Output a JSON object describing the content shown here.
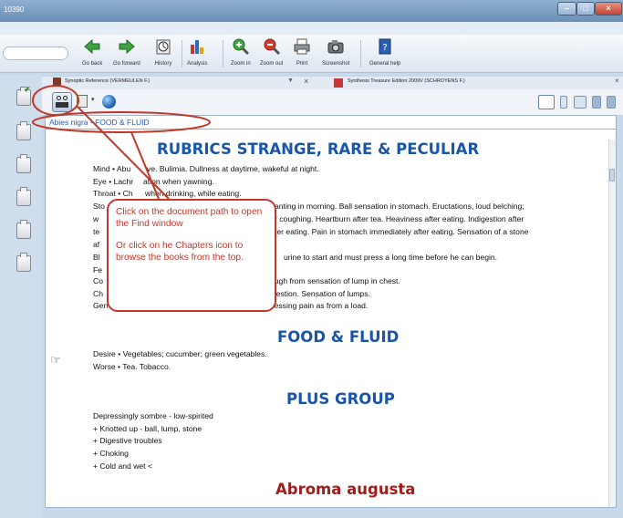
{
  "window": {
    "title": "10390"
  },
  "toolbar": {
    "go_back": "Go back",
    "go_forward": "Go forward",
    "history": "History",
    "analysis": "Analysis",
    "zoom_in": "Zoom in",
    "zoom_out": "Zoom out",
    "print": "Print",
    "screenshot": "Screenshot",
    "general_help": "General help"
  },
  "tabs": [
    {
      "label": "Synoptic Reference  (VERMEULEN F.)"
    },
    {
      "label": "Synthesis Treasure Edition 2009V (SCHROYENS F.)"
    }
  ],
  "document": {
    "path": "Abies nigra - FOOD & FLUID",
    "heading1": "RUBRICS STRANGE, RARE & PECULIAR",
    "rubric_lines": [
      "Mind • Abu",
      "ve. Bulimia. Dullness at daytime, wakeful at night.",
      "Eye • Lachr",
      "ation when yawning.",
      "Throat • Ch",
      "when drinking, while eating.",
      "Sto",
      "anting in morning. Ball sensation in stomach. Eructations, loud belching;",
      "w",
      "r coughing. Heartburn after tea. Heaviness after eating. Indigestion after",
      "te",
      "ter eating. Pain in stomach immediately after eating. Sensation of a stone",
      "af",
      "Bl",
      "urine to start and must press a long time before he can begin.",
      "Fe",
      "Co",
      "ough from sensation of lump in chest.",
      "Ch",
      "igestion. Sensation of lumps.",
      "Gen",
      "Pressing pain as from a load."
    ],
    "heading2": "FOOD & FLUID",
    "food_lines": [
      "Desire • Vegetables; cucumber; green vegetables.",
      "Worse • Tea. Tobacco."
    ],
    "heading3": "PLUS GROUP",
    "plus_lines": [
      "Depressingly sombre - low-spirited",
      "+ Knotted up - ball, lump, stone",
      "+ Digestive troubles",
      "+ Choking",
      "+ Cold and wet <"
    ],
    "heading4": "Abroma augusta"
  },
  "callout": {
    "line1": "Click on the document path to open the Find window",
    "line2": "Or click on he Chapters icon to browse the books from the top."
  },
  "colors": {
    "heading_blue": "#1a55a8",
    "heading_red": "#a11d1d",
    "annotation_red": "#c0392b",
    "link": "#2a57b4"
  }
}
